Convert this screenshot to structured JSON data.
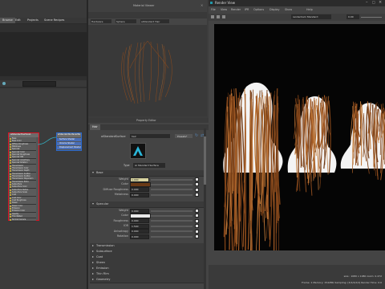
{
  "left_panel": {
    "tabs": [
      "Browse",
      "Edit",
      "Projects",
      "Scene Recipes"
    ],
    "node_editor": {
      "node1": {
        "name": "aiStandardSurface1",
        "attrs": [
          "Base",
          "Base Color",
          "Diffuse Roughness",
          "Metalness",
          "Specular",
          "Specular Color",
          "Specular Roughness",
          "Specular IOR",
          "Specular Anisotropy",
          "Specular Rotation",
          "Transmission",
          "Transmission Color",
          "Transmission Depth",
          "Transmission Scatter",
          "Transmission Scatter Anisotropy",
          "Transmission Dispersion",
          "Transmission Extra Roughness",
          "Subsurface",
          "Subsurface Color",
          "Subsurface Radius",
          "Subsurface Scale",
          "Coat",
          "Coat Color",
          "Coat Roughness",
          "Sheen",
          "Sheen Color",
          "Emission",
          "Emission Color",
          "Opacity",
          "Thin Walled",
          "Normal Camera"
        ]
      },
      "node2": {
        "name": "aiStandardSurface2SG",
        "attrs": [
          "Surface Shader",
          "Volume Shader",
          "Displacement Shader"
        ]
      }
    }
  },
  "viewport": {
    "title": "Material Viewer",
    "renderer": "Hardware",
    "shape": "Sphere",
    "shader": "aiStandard Hair"
  },
  "property_editor": {
    "title": "Property Editor",
    "tab": "Hair",
    "name_label": "aiStandardSurface",
    "name_value": "hair",
    "preset_label": "Presets*",
    "type_label": "Type",
    "type_value": "Ai Standard Surface",
    "sections": {
      "base": "Base",
      "specular": "Specular",
      "transmission": "Transmission",
      "subsurface": "Subsurface",
      "coat": "Coat",
      "sheen": "Sheen",
      "emission": "Emission",
      "thin_film": "Thin Film",
      "geometry": "Geometry"
    },
    "base_rows": [
      {
        "label": "Weight",
        "value": "1.000"
      },
      {
        "label": "Color",
        "value": ""
      },
      {
        "label": "Diffuse Roughness",
        "value": "0.000"
      },
      {
        "label": "Metalness",
        "value": "0.000"
      }
    ],
    "specular_rows": [
      {
        "label": "Weight",
        "value": "0.000"
      },
      {
        "label": "Color",
        "value": ""
      },
      {
        "label": "Roughness",
        "value": "0.000"
      },
      {
        "label": "IOR",
        "value": "1.500"
      },
      {
        "label": "Anisotropy",
        "value": "0.000"
      },
      {
        "label": "Rotation",
        "value": "0.000"
      }
    ]
  },
  "render_view": {
    "title": "Render View",
    "menu": [
      "File",
      "View",
      "Render",
      "IPR",
      "Options",
      "Display",
      "Show",
      "Help"
    ],
    "camera": "renderCam Standard",
    "zoom": "0.00",
    "status": "size : 1080 x 1080 zoom: 0.472",
    "status2": "Frame: 1   Memory: 1542Mb   Sampling: [3/2/2/2/2]   Render Time: 0:0",
    "colors": {
      "hair": "#8a4a1e",
      "bg": "#050505"
    }
  }
}
